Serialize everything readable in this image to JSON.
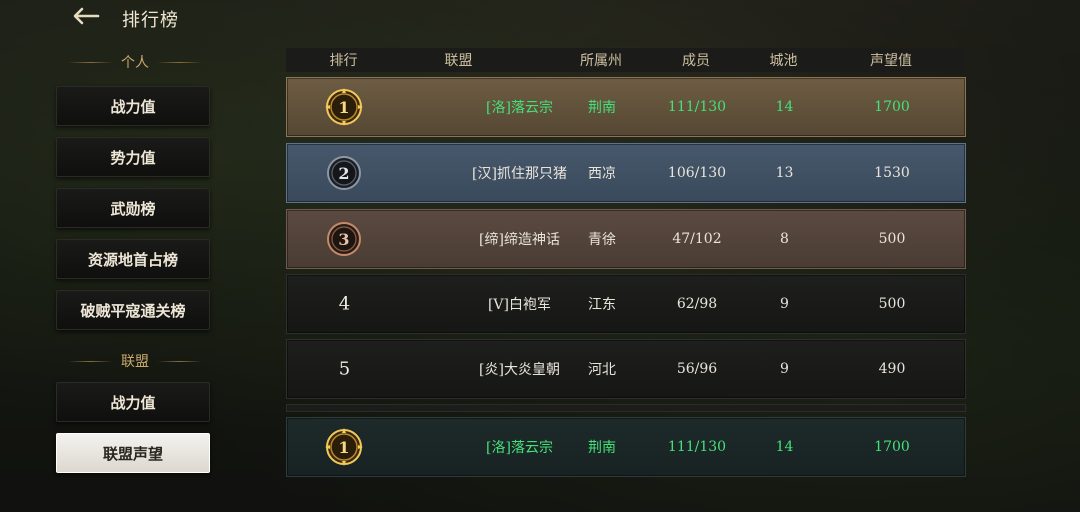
{
  "header": {
    "title": "排行榜"
  },
  "sidebar": {
    "personal_header": "个人",
    "personal_items": [
      {
        "label": "战力值"
      },
      {
        "label": "势力值"
      },
      {
        "label": "武勋榜"
      },
      {
        "label": "资源地首占榜"
      },
      {
        "label": "破贼平寇通关榜"
      }
    ],
    "alliance_header": "联盟",
    "alliance_items": [
      {
        "label": "战力值"
      },
      {
        "label": "联盟声望"
      }
    ],
    "active_item": "联盟声望"
  },
  "table": {
    "headers": {
      "rank": "排行",
      "alliance": "联盟",
      "state": "所属州",
      "members": "成员",
      "cities": "城池",
      "prestige": "声望值"
    },
    "rows": [
      {
        "rank": "1",
        "alliance": "[洛]落云宗",
        "state": "荆南",
        "members": "111/130",
        "cities": "14",
        "prestige": "1700"
      },
      {
        "rank": "2",
        "alliance": "[汉]抓住那只猪",
        "state": "西凉",
        "members": "106/130",
        "cities": "13",
        "prestige": "1530"
      },
      {
        "rank": "3",
        "alliance": "[缔]缔造神话",
        "state": "青徐",
        "members": "47/102",
        "cities": "8",
        "prestige": "500"
      },
      {
        "rank": "4",
        "alliance": "[V]白袍军",
        "state": "江东",
        "members": "62/98",
        "cities": "9",
        "prestige": "500"
      },
      {
        "rank": "5",
        "alliance": "[炎]大炎皇朝",
        "state": "河北",
        "members": "56/96",
        "cities": "9",
        "prestige": "490"
      }
    ],
    "my_alliance": {
      "rank": "1",
      "alliance": "[洛]落云宗",
      "state": "荆南",
      "members": "111/130",
      "cities": "14",
      "prestige": "1700"
    }
  },
  "icons": {
    "back": "back-arrow-icon",
    "medal_gold": "gold-medal-icon",
    "medal_dark": "dark-medal-icon",
    "medal_bronze": "bronze-medal-icon"
  },
  "colors": {
    "highlight_green": "#46e07a",
    "gold": "#c9a96a"
  }
}
